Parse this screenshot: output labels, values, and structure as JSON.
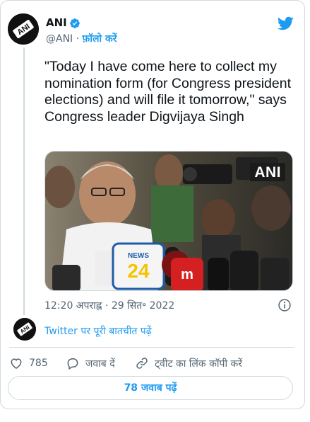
{
  "author": {
    "name": "ANI",
    "handle": "@ANI",
    "separator": "·",
    "follow_label": "फ़ॉलो करें",
    "avatar_logo_text": "ANI"
  },
  "icons": {
    "verified": "verified-badge-icon",
    "brand": "twitter-bird-icon",
    "info": "info-icon",
    "like": "heart-icon",
    "reply": "speech-bubble-icon",
    "copy_link": "link-icon"
  },
  "tweet": {
    "text": "\"Today I have come here to collect my nomination form (for Congress president elections) and will file it tomorrow,\" says Congress leader Digvijaya Singh",
    "media": {
      "watermark": "ANI",
      "mic_labels": [
        "NEWS",
        "24",
        "m"
      ]
    },
    "timestamp": "12:20 अपराह्न · 29 सित॰ 2022"
  },
  "thread_link": "Twitter पर पूरी बातचीत पढ़ें",
  "actions": {
    "like_count": "785",
    "reply_label": "जवाब दें",
    "copy_link_label": "ट्वीट का लिंक कॉपी करें"
  },
  "read_replies_label": "78 जवाब पढ़ें",
  "colors": {
    "accent": "#1d9bf0",
    "text_primary": "#0f1419",
    "text_secondary": "#536471",
    "border": "#cfd9de"
  }
}
